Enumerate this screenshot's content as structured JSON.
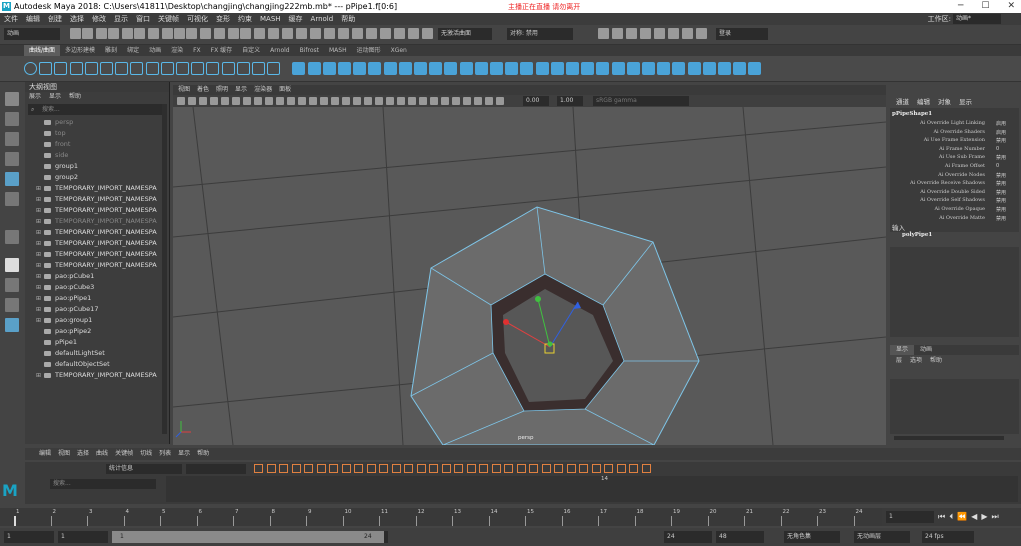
{
  "window": {
    "title": "Autodesk Maya 2018: C:\\Users\\41811\\Desktop\\changjing\\changjing222mb.mb*  ---  pPipe1.f[0:6]",
    "overlay_text": "主播正在直播 请勿离开",
    "minimize": "─",
    "maximize": "☐",
    "close": "✕"
  },
  "menu": [
    "文件",
    "编辑",
    "创建",
    "选择",
    "修改",
    "显示",
    "窗口",
    "关键帧",
    "可视化",
    "变形",
    "约束",
    "MASH",
    "缓存",
    "Arnold",
    "帮助"
  ],
  "workspace": {
    "label": "工作区:",
    "value": "动画*"
  },
  "toolbar": {
    "mode": "动画",
    "no_live_surface": "无激活曲面",
    "symmetry": "对称: 禁用",
    "login": "登录"
  },
  "shelf_tabs": [
    "曲线/曲面",
    "多边形建模",
    "雕刻",
    "绑定",
    "动画",
    "渲染",
    "FX",
    "FX 缓存",
    "自定义",
    "Arnold",
    "Bifrost",
    "MASH",
    "运动图形",
    "XGen"
  ],
  "shelf_active": 0,
  "outliner": {
    "title": "大纲视图",
    "menu": [
      "展示",
      "显示",
      "帮助"
    ],
    "search_placeholder": "搜索...",
    "items": [
      {
        "label": "persp",
        "dim": true,
        "exp": ""
      },
      {
        "label": "top",
        "dim": true,
        "exp": ""
      },
      {
        "label": "front",
        "dim": true,
        "exp": ""
      },
      {
        "label": "side",
        "dim": true,
        "exp": ""
      },
      {
        "label": "group1",
        "dim": false,
        "exp": ""
      },
      {
        "label": "group2",
        "dim": false,
        "exp": ""
      },
      {
        "label": "TEMPORARY_IMPORT_NAMESPA",
        "dim": false,
        "exp": "⊞"
      },
      {
        "label": "TEMPORARY_IMPORT_NAMESPA",
        "dim": false,
        "exp": "⊞"
      },
      {
        "label": "TEMPORARY_IMPORT_NAMESPA",
        "dim": false,
        "exp": "⊞"
      },
      {
        "label": "TEMPORARY_IMPORT_NAMESPA",
        "dim": true,
        "exp": "⊞"
      },
      {
        "label": "TEMPORARY_IMPORT_NAMESPA",
        "dim": false,
        "exp": "⊞"
      },
      {
        "label": "TEMPORARY_IMPORT_NAMESPA",
        "dim": false,
        "exp": "⊞"
      },
      {
        "label": "TEMPORARY_IMPORT_NAMESPA",
        "dim": false,
        "exp": "⊞"
      },
      {
        "label": "TEMPORARY_IMPORT_NAMESPA",
        "dim": false,
        "exp": "⊞"
      },
      {
        "label": "pao:pCube1",
        "dim": false,
        "exp": "⊞"
      },
      {
        "label": "pao:pCube3",
        "dim": false,
        "exp": "⊞"
      },
      {
        "label": "pao:pPipe1",
        "dim": false,
        "exp": "⊞"
      },
      {
        "label": "pao:pCube17",
        "dim": false,
        "exp": "⊞"
      },
      {
        "label": "pao:group1",
        "dim": false,
        "exp": "⊞"
      },
      {
        "label": "pao:pPipe2",
        "dim": false,
        "exp": ""
      },
      {
        "label": "pPipe1",
        "dim": false,
        "exp": ""
      },
      {
        "label": "defaultLightSet",
        "dim": false,
        "exp": ""
      },
      {
        "label": "defaultObjectSet",
        "dim": false,
        "exp": ""
      },
      {
        "label": "TEMPORARY_IMPORT_NAMESPA",
        "dim": false,
        "exp": "⊞"
      }
    ]
  },
  "viewport": {
    "menu": [
      "视图",
      "着色",
      "照明",
      "显示",
      "渲染器",
      "面板"
    ],
    "exposure": "0.00",
    "gamma": "1.00",
    "color_space": "sRGB gamma",
    "camera_label": "persp"
  },
  "channel_box": {
    "menu": [
      "通道",
      "编辑",
      "对象",
      "显示"
    ],
    "shape_name": "pPipeShape1",
    "attrs": [
      {
        "name": "Ai Override Light Linking",
        "value": "启用"
      },
      {
        "name": "Ai Override Shaders",
        "value": "启用"
      },
      {
        "name": "Ai Use Frame Extension",
        "value": "禁用"
      },
      {
        "name": "Ai Frame Number",
        "value": "0"
      },
      {
        "name": "Ai Use Sub Frame",
        "value": "禁用"
      },
      {
        "name": "Ai Frame Offset",
        "value": "0"
      },
      {
        "name": "Ai Override Nodes",
        "value": "禁用"
      },
      {
        "name": "Ai Override Receive Shadows",
        "value": "禁用"
      },
      {
        "name": "Ai Override Double Sided",
        "value": "禁用"
      },
      {
        "name": "Ai Override Self Shadows",
        "value": "禁用"
      },
      {
        "name": "Ai Override Opaque",
        "value": "禁用"
      },
      {
        "name": "Ai Override Matte",
        "value": "禁用"
      }
    ],
    "inputs_label": "输入",
    "input_node": "polyPipe1",
    "layer_tabs": [
      "显示",
      "动画"
    ],
    "layer_menu": [
      "层",
      "选项",
      "帮助"
    ]
  },
  "graph_editor": {
    "menu": [
      "编辑",
      "视图",
      "选择",
      "曲线",
      "关键帧",
      "切线",
      "列表",
      "显示",
      "帮助"
    ],
    "stats": "统计信息",
    "search": "搜索...",
    "frame": "14"
  },
  "timeline": {
    "ticks": [
      "1",
      "2",
      "3",
      "4",
      "5",
      "6",
      "7",
      "8",
      "9",
      "10",
      "11",
      "12",
      "13",
      "14",
      "15",
      "16",
      "17",
      "18",
      "19",
      "20",
      "21",
      "22",
      "23",
      "24"
    ],
    "current_frame": "1"
  },
  "range": {
    "start": "1",
    "inner_start": "1",
    "slider_start": "1",
    "slider_end": "24",
    "end": "24",
    "anim_end": "48",
    "character": "无角色集",
    "anim_layer": "无动画层",
    "fps": "24 fps"
  }
}
